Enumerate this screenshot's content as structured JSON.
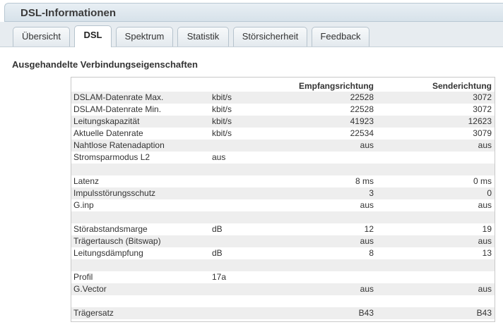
{
  "window": {
    "title": "DSL-Informationen"
  },
  "tabs": [
    {
      "label": "Übersicht",
      "active": false
    },
    {
      "label": "DSL",
      "active": true
    },
    {
      "label": "Spektrum",
      "active": false
    },
    {
      "label": "Statistik",
      "active": false
    },
    {
      "label": "Störsicherheit",
      "active": false
    },
    {
      "label": "Feedback",
      "active": false
    }
  ],
  "section": {
    "title": "Ausgehandelte Verbindungseigenschaften"
  },
  "table": {
    "headers": {
      "label": "",
      "unit": "",
      "rx": "Empfangsrichtung",
      "tx": "Senderichtung"
    },
    "rows": [
      {
        "label": "DSLAM-Datenrate Max.",
        "unit": "kbit/s",
        "rx": "22528",
        "tx": "3072"
      },
      {
        "label": "DSLAM-Datenrate Min.",
        "unit": "kbit/s",
        "rx": "22528",
        "tx": "3072"
      },
      {
        "label": "Leitungskapazität",
        "unit": "kbit/s",
        "rx": "41923",
        "tx": "12623"
      },
      {
        "label": "Aktuelle Datenrate",
        "unit": "kbit/s",
        "rx": "22534",
        "tx": "3079"
      },
      {
        "label": "Nahtlose Ratenadaption",
        "unit": "",
        "rx": "aus",
        "tx": "aus"
      },
      {
        "label": "Stromsparmodus L2",
        "unit": "aus",
        "rx": "",
        "tx": ""
      },
      {
        "label": "",
        "unit": "",
        "rx": "",
        "tx": ""
      },
      {
        "label": "Latenz",
        "unit": "",
        "rx": "8 ms",
        "tx": "0 ms"
      },
      {
        "label": "Impulsstörungsschutz",
        "unit": "",
        "rx": "3",
        "tx": "0"
      },
      {
        "label": "G.inp",
        "unit": "",
        "rx": "aus",
        "tx": "aus"
      },
      {
        "label": "",
        "unit": "",
        "rx": "",
        "tx": ""
      },
      {
        "label": "Störabstandsmarge",
        "unit": "dB",
        "rx": "12",
        "tx": "19"
      },
      {
        "label": "Trägertausch (Bitswap)",
        "unit": "",
        "rx": "aus",
        "tx": "aus"
      },
      {
        "label": "Leitungsdämpfung",
        "unit": "dB",
        "rx": "8",
        "tx": "13"
      },
      {
        "label": "",
        "unit": "",
        "rx": "",
        "tx": ""
      },
      {
        "label": "Profil",
        "unit": "17a",
        "rx": "",
        "tx": ""
      },
      {
        "label": "G.Vector",
        "unit": "",
        "rx": "aus",
        "tx": "aus"
      },
      {
        "label": "",
        "unit": "",
        "rx": "",
        "tx": ""
      },
      {
        "label": "Trägersatz",
        "unit": "",
        "rx": "B43",
        "tx": "B43"
      }
    ]
  }
}
